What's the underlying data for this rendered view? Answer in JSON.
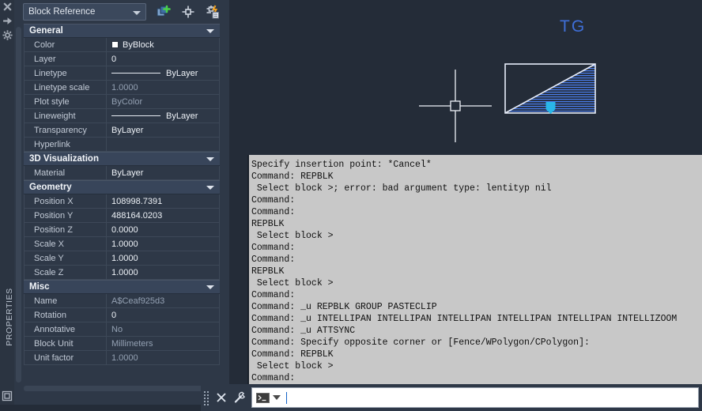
{
  "app": {
    "palette_title": "PROPERTIES",
    "object_type": "Block Reference"
  },
  "palette": {
    "tools": [
      {
        "name": "quick-select-icon",
        "label": "Quick Select"
      },
      {
        "name": "pick-point-icon",
        "label": "Select Objects"
      },
      {
        "name": "quick-calculator-icon",
        "label": "Quick Calculator"
      }
    ],
    "categories": [
      {
        "label": "General",
        "rows": [
          {
            "name": "Color",
            "value": "ByBlock",
            "swatch": "#ffffff",
            "muted": false
          },
          {
            "name": "Layer",
            "value": "0",
            "muted": false
          },
          {
            "name": "Linetype",
            "value": "ByLayer",
            "line": true,
            "muted": false
          },
          {
            "name": "Linetype scale",
            "value": "1.0000",
            "muted": true
          },
          {
            "name": "Plot style",
            "value": "ByColor",
            "muted": true
          },
          {
            "name": "Lineweight",
            "value": "ByLayer",
            "line": true,
            "muted": false
          },
          {
            "name": "Transparency",
            "value": "ByLayer",
            "muted": false
          },
          {
            "name": "Hyperlink",
            "value": "",
            "muted": false
          }
        ]
      },
      {
        "label": "3D Visualization",
        "rows": [
          {
            "name": "Material",
            "value": "ByLayer",
            "muted": false
          }
        ]
      },
      {
        "label": "Geometry",
        "rows": [
          {
            "name": "Position X",
            "value": "108998.7391",
            "muted": false
          },
          {
            "name": "Position Y",
            "value": "488164.0203",
            "muted": false
          },
          {
            "name": "Position Z",
            "value": "0.0000",
            "muted": false
          },
          {
            "name": "Scale X",
            "value": "1.0000",
            "muted": false
          },
          {
            "name": "Scale Y",
            "value": "1.0000",
            "muted": false
          },
          {
            "name": "Scale Z",
            "value": "1.0000",
            "muted": false
          }
        ]
      },
      {
        "label": "Misc",
        "rows": [
          {
            "name": "Name",
            "value": "A$Ceaf925d3",
            "muted": true
          },
          {
            "name": "Rotation",
            "value": "0",
            "muted": false
          },
          {
            "name": "Annotative",
            "value": "No",
            "muted": true
          },
          {
            "name": "Block Unit",
            "value": "Millimeters",
            "muted": true
          },
          {
            "name": "Unit factor",
            "value": "1.0000",
            "muted": true
          }
        ]
      }
    ]
  },
  "canvas": {
    "text_label": "TG",
    "label_color": "#3f6fd8",
    "block_color": "#4a7ff0",
    "grip_color": "#29b6e8",
    "background": "#242c38"
  },
  "command_history": {
    "lines": [
      "Specify insertion point: *Cancel*",
      "Command: REPBLK",
      " Select block >; error: bad argument type: lentityp nil",
      "Command:",
      "Command:",
      "REPBLK",
      " Select block >",
      "Command:",
      "Command:",
      "REPBLK",
      " Select block >",
      "Command:",
      "Command: _u REPBLK GROUP PASTECLIP",
      "Command: _u INTELLIPAN INTELLIPAN INTELLIPAN INTELLIPAN INTELLIPAN INTELLIZOOM",
      "Command: _u ATTSYNC",
      "Command: Specify opposite corner or [Fence/WPolygon/CPolygon]:",
      "Command: REPBLK",
      " Select block >",
      "Command:"
    ]
  },
  "command_bar": {
    "input_value": "",
    "input_placeholder": "",
    "icons": [
      {
        "name": "close-icon"
      },
      {
        "name": "wrench-icon"
      },
      {
        "name": "console-prompt-icon"
      }
    ]
  }
}
